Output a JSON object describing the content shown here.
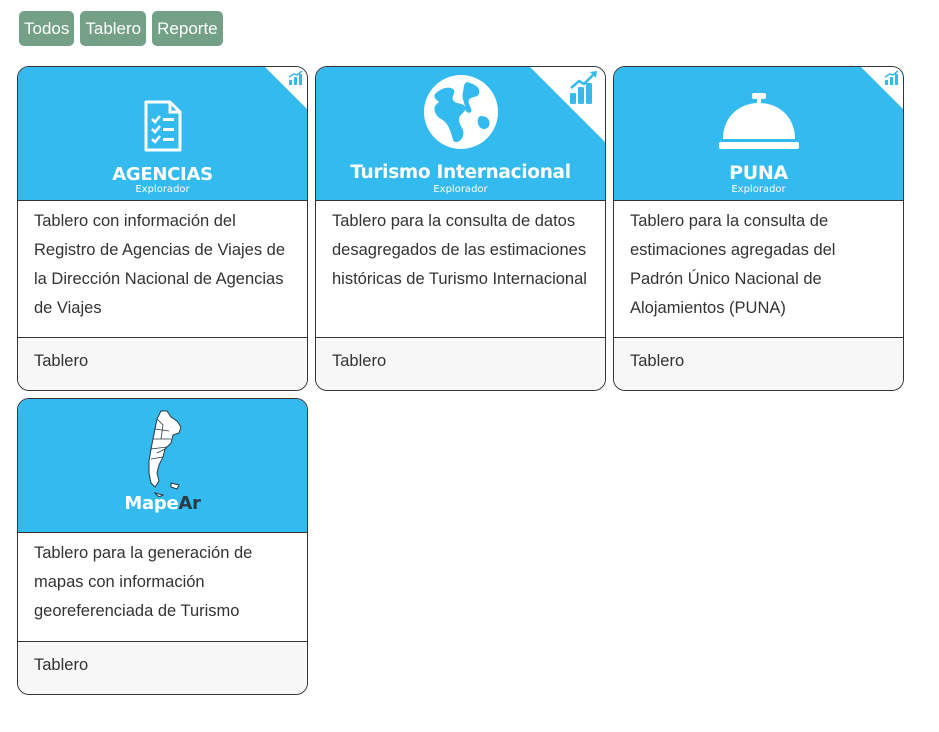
{
  "filters": [
    {
      "label": "Todos"
    },
    {
      "label": "Tablero"
    },
    {
      "label": "Reporte"
    }
  ],
  "cards": [
    {
      "title": "AGENCIAS",
      "subtitle": "Explorador",
      "icon": "checklist-icon",
      "description": "Tablero con información del Registro de Agencias de Viajes de la Dirección Nacional de Agencias de Viajes",
      "footer": "Tablero"
    },
    {
      "title": "Turismo Internacional",
      "subtitle": "Explorador",
      "icon": "globe-icon",
      "description": "Tablero para la consulta de datos desagregados de las estimaciones históricas de Turismo Internacional",
      "footer": "Tablero"
    },
    {
      "title": "PUNA",
      "subtitle": "Explorador",
      "icon": "service-bell-icon",
      "description": "Tablero para la consulta de estimaciones agregadas del Padrón Único Nacional de Alojamientos (PUNA)",
      "footer": "Tablero"
    },
    {
      "title_part1": "Mape",
      "title_part2": "Ar",
      "icon": "argentina-map-icon",
      "description": "Tablero para la generación de mapas con información georeferenciada de Turismo",
      "footer": "Tablero"
    }
  ],
  "colors": {
    "filter_bg": "#73a087",
    "banner_bg": "#33baee",
    "footer_bg": "#f7f7f7",
    "border": "#333333"
  }
}
